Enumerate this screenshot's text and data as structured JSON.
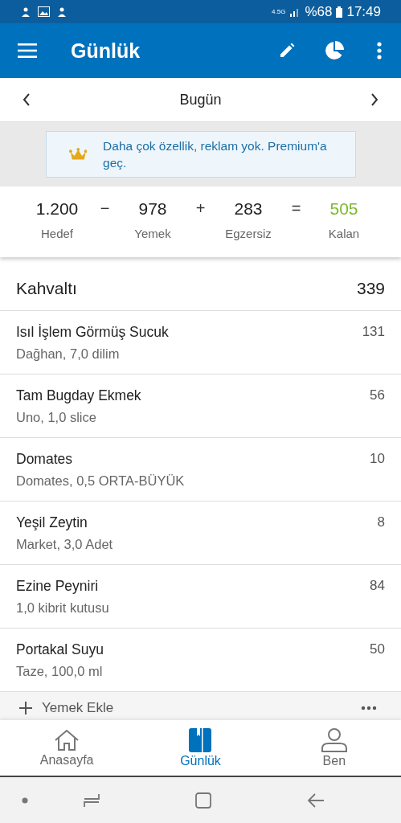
{
  "status_bar": {
    "network": "4.5G",
    "battery": "%68",
    "time": "17:49"
  },
  "app_bar": {
    "title": "Günlük"
  },
  "date_nav": {
    "label": "Bugün"
  },
  "banner": {
    "text": "Daha çok özellik, reklam yok. Premium'a geç."
  },
  "summary": [
    {
      "kind": "value",
      "value": "1.200",
      "label": "Hedef"
    },
    {
      "kind": "operator",
      "value": "−"
    },
    {
      "kind": "value",
      "value": "978",
      "label": "Yemek"
    },
    {
      "kind": "operator",
      "value": "+"
    },
    {
      "kind": "value",
      "value": "283",
      "label": "Egzersiz"
    },
    {
      "kind": "operator",
      "value": "="
    },
    {
      "kind": "result",
      "value": "505",
      "label": "Kalan"
    }
  ],
  "meal": {
    "name": "Kahvaltı",
    "calories": "339",
    "items": [
      {
        "name": "Isıl İşlem Görmüş Sucuk",
        "detail": "Dağhan, 7,0 dilim",
        "calories": "131"
      },
      {
        "name": "Tam Bugday Ekmek",
        "detail": "Uno, 1,0 slice",
        "calories": "56"
      },
      {
        "name": "Domates",
        "detail": "Domates, 0,5 ORTA-BÜYÜK",
        "calories": "10"
      },
      {
        "name": "Yeşil Zeytin",
        "detail": "Market, 3,0 Adet",
        "calories": "8"
      },
      {
        "name": "Ezine Peyniri",
        "detail": "1,0 kibrit kutusu",
        "calories": "84"
      },
      {
        "name": "Portakal Suyu",
        "detail": "Taze, 100,0 ml",
        "calories": "50"
      }
    ],
    "add_label": "Yemek Ekle"
  },
  "bottom_nav": [
    {
      "label": "Anasayfa",
      "kind": "home",
      "selected": false
    },
    {
      "label": "Günlük",
      "kind": "diary",
      "selected": true
    },
    {
      "label": "Ben",
      "kind": "profile",
      "selected": false
    }
  ]
}
